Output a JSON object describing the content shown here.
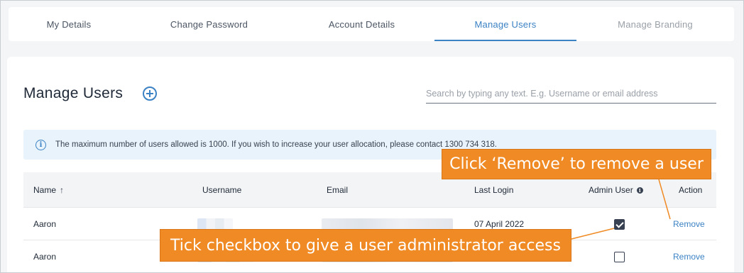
{
  "tabs": [
    {
      "label": "My Details",
      "active": false
    },
    {
      "label": "Change Password",
      "active": false
    },
    {
      "label": "Account Details",
      "active": false
    },
    {
      "label": "Manage Users",
      "active": true
    },
    {
      "label": "Manage Branding",
      "active": false
    }
  ],
  "page": {
    "title": "Manage Users",
    "add_icon": "plus-circle-icon"
  },
  "search": {
    "placeholder": "Search by typing any text. E.g. Username or email address"
  },
  "info_banner": {
    "icon": "info-circle-icon",
    "text": "The maximum number of users allowed is 1000. If you wish to increase your user allocation, please contact 1300 734 318."
  },
  "table": {
    "headers": {
      "name": "Name",
      "username": "Username",
      "email": "Email",
      "last_login": "Last Login",
      "admin_user": "Admin User",
      "action": "Action"
    },
    "sort_icon": "arrow-up-icon",
    "rows": [
      {
        "name": "Aaron",
        "last_login": "07 April 2022",
        "admin": true,
        "action": "Remove"
      },
      {
        "name": "Aaron",
        "last_login": "",
        "admin": false,
        "action": "Remove"
      }
    ]
  },
  "callouts": {
    "remove": "Click ‘Remove’ to remove a user",
    "admin": "Tick checkbox to give a user administrator access"
  },
  "colors": {
    "accent": "#3b82c4",
    "callout": "#f08a24",
    "info_bg": "#e8f3fb"
  }
}
